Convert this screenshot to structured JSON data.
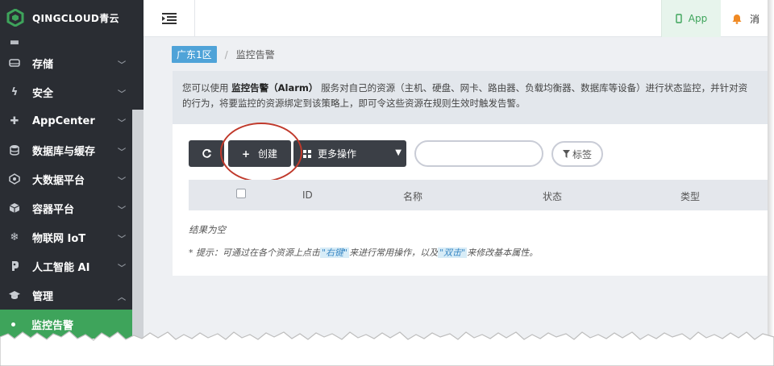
{
  "brand": {
    "name": "QINGCLOUD青云",
    "logo_color": "#3ea45b"
  },
  "sidebar": {
    "items": [
      {
        "label": "",
        "icon": "partial-icon",
        "partial": true
      },
      {
        "label": "存储",
        "icon": "storage-icon"
      },
      {
        "label": "安全",
        "icon": "bolt-icon"
      },
      {
        "label": "AppCenter",
        "icon": "puzzle-icon"
      },
      {
        "label": "数据库与缓存",
        "icon": "database-icon"
      },
      {
        "label": "大数据平台",
        "icon": "bigdata-icon"
      },
      {
        "label": "容器平台",
        "icon": "cube-icon"
      },
      {
        "label": "物联网 IoT",
        "icon": "snowflake-icon"
      },
      {
        "label": "人工智能 AI",
        "icon": "brain-icon"
      },
      {
        "label": "管理",
        "icon": "graduation-cap-icon",
        "expanded": true
      }
    ],
    "active_sub": "监控告警"
  },
  "topbar": {
    "app_label": "App",
    "msg_label": "消"
  },
  "breadcrumb": {
    "zone": "广东1区",
    "separator": "/",
    "current": "监控告警"
  },
  "info": {
    "line1_prefix": "您可以使用",
    "line1_bold": "监控告警（Alarm）",
    "line1_rest": "服务对自己的资源（主机、硬盘、网卡、路由器、负载均衡器、数据库等设备）进行状态监控，并针对资",
    "line2": "的行为，将要监控的资源绑定到该策略上，即可令这些资源在规则生效时触发告警。"
  },
  "toolbar": {
    "refresh_icon": "refresh-icon",
    "create_label": "创建",
    "more_label": "更多操作",
    "search_placeholder": "",
    "tag_label": "标签"
  },
  "table": {
    "columns": [
      "ID",
      "名称",
      "状态",
      "类型"
    ],
    "empty_text": "结果为空"
  },
  "tip": {
    "prefix": "* 提示：可通过在各个资源上点击",
    "right_click": "\"右键\"",
    "middle": "来进行常用操作，以及",
    "double_click": "\"双击\"",
    "suffix": "来修改基本属性。"
  },
  "colors": {
    "accent": "#3ea45b",
    "sidebar_bg": "#2a2d33",
    "button_dark": "#3b3f46",
    "zone_badge": "#4fa3d8",
    "annotation": "#c0392b"
  }
}
